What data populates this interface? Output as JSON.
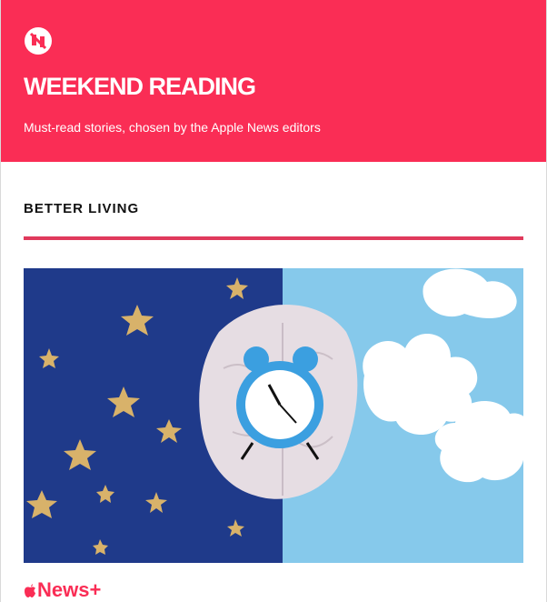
{
  "header": {
    "logo_icon": "apple-news-icon",
    "title": "WEEKEND READING",
    "subtitle": "Must-read stories, chosen by the Apple News editors",
    "background": "#fa2d55"
  },
  "section": {
    "label": "BETTER LIVING",
    "divider_color": "#e03a5c"
  },
  "story": {
    "image_icon": "brain-alarm-clock-image",
    "brand_label": "News+",
    "brand_icon": "apple-logo-icon"
  }
}
